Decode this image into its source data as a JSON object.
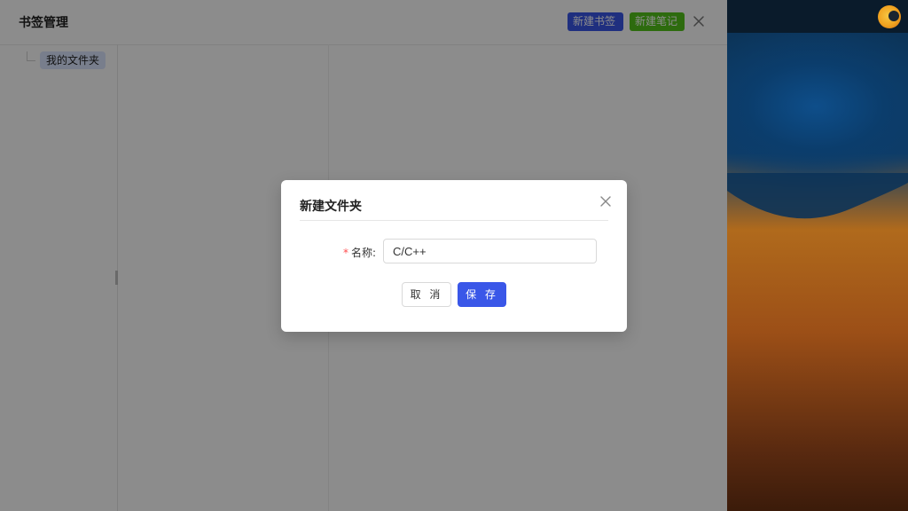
{
  "app": {
    "title": "书签管理",
    "buttons": {
      "new_bookmark": "新建书签",
      "new_note": "新建笔记"
    }
  },
  "tree": {
    "items": [
      {
        "label": "我的文件夹",
        "selected": true
      }
    ]
  },
  "modal": {
    "title": "新建文件夹",
    "field": {
      "required_mark": "*",
      "label": "名称:",
      "value": "C/C++"
    },
    "buttons": {
      "cancel": "取 消",
      "save": "保 存"
    }
  },
  "colors": {
    "primary": "#3a57e8",
    "success": "#52c41a",
    "required": "#ff4d4f",
    "overlay": "rgba(0,0,0,0.45)"
  },
  "icons": {
    "header_close": "close-icon",
    "modal_close": "close-icon",
    "app_logo": "app-logo"
  }
}
